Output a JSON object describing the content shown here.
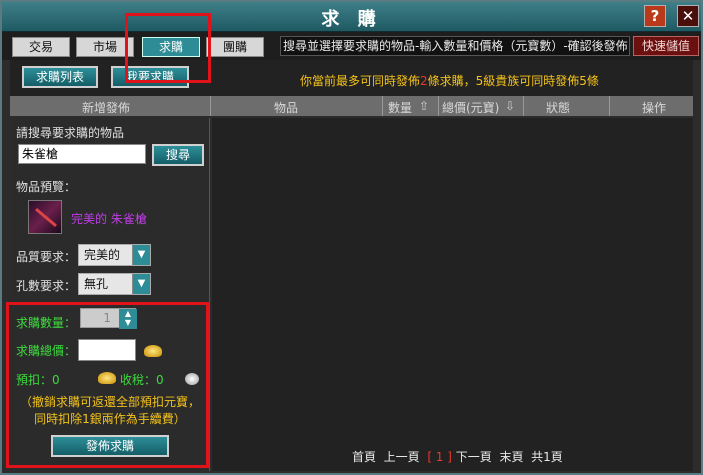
{
  "window": {
    "title": "求 購",
    "help_label": "?",
    "close_label": "✕"
  },
  "tabs": [
    {
      "label": "交易"
    },
    {
      "label": "市場"
    },
    {
      "label": "求購"
    },
    {
      "label": "團購"
    }
  ],
  "hint_text": "搜尋並選擇要求購的物品-輸入數量和價格（元寶數）-確認後發佈",
  "quick_save_label": "快速儲值",
  "subbar": {
    "list_button": "求購列表",
    "mine_button": "我要求購",
    "quota_prefix": "你當前最多可同時發佈",
    "quota_number": "2",
    "quota_suffix": "條求購，5級貴族可同時發佈5條"
  },
  "columns": {
    "new_post": "新增發佈",
    "item": "物品",
    "quantity": "數量",
    "total_price": "總價(元寶)",
    "status": "狀態",
    "action": "操作"
  },
  "left": {
    "search_label": "請搜尋要求購的物品",
    "search_value": "朱雀槍",
    "search_button": "搜尋",
    "preview_label": "物品預覽：",
    "item_name": "完美的 朱雀槍",
    "quality_label": "品質要求：",
    "quality_value": "完美的",
    "holes_label": "孔數要求：",
    "holes_value": "無孔",
    "qty_label": "求購數量：",
    "qty_value": "1",
    "price_label": "求購總價：",
    "price_value": "",
    "prepaid_label": "預扣：0",
    "tax_label": "收稅：0",
    "note": "（撤銷求購可返還全部預扣元寶，同時扣除1銀兩作為手續費）",
    "publish_button": "發佈求購"
  },
  "pager": {
    "first": "首頁",
    "prev": "上一頁",
    "current": "[ 1 ]",
    "next": "下一頁",
    "last": "末頁",
    "total": "共1頁"
  },
  "colors": {
    "accent_teal": "#2d8c95",
    "highlight_red": "#e0121a",
    "quota_yellow": "#f3c21a",
    "item_purple": "#c03de8"
  }
}
